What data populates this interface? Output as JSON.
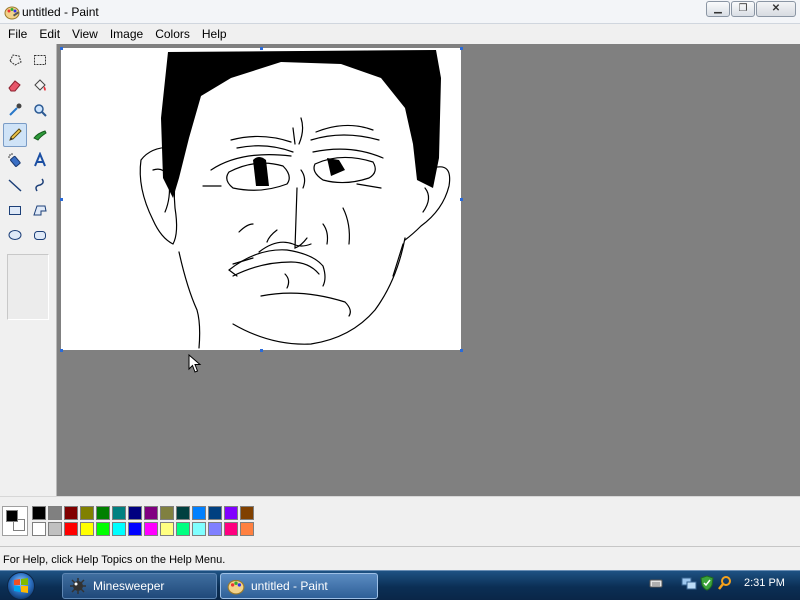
{
  "window": {
    "title": "untitled - Paint",
    "icon": "paint-app-icon",
    "controls": [
      "minimize-icon",
      "maximize-icon",
      "close-icon"
    ]
  },
  "menu": [
    "File",
    "Edit",
    "View",
    "Image",
    "Colors",
    "Help"
  ],
  "tools": [
    {
      "name": "free-form-select",
      "icon": "free-form-select-icon"
    },
    {
      "name": "select",
      "icon": "rect-select-icon"
    },
    {
      "name": "eraser",
      "icon": "eraser-icon"
    },
    {
      "name": "fill-with-color",
      "icon": "paint-bucket-icon"
    },
    {
      "name": "pick-color",
      "icon": "eyedropper-icon"
    },
    {
      "name": "magnifier",
      "icon": "magnifier-icon"
    },
    {
      "name": "pencil",
      "icon": "pencil-icon",
      "active": true
    },
    {
      "name": "brush",
      "icon": "brush-icon"
    },
    {
      "name": "airbrush",
      "icon": "airbrush-icon"
    },
    {
      "name": "text",
      "icon": "text-icon"
    },
    {
      "name": "line",
      "icon": "line-icon"
    },
    {
      "name": "curve",
      "icon": "curve-icon"
    },
    {
      "name": "rectangle",
      "icon": "rectangle-icon"
    },
    {
      "name": "polygon",
      "icon": "polygon-icon"
    },
    {
      "name": "ellipse",
      "icon": "ellipse-icon"
    },
    {
      "name": "rounded-rectangle",
      "icon": "rounded-rectangle-icon"
    }
  ],
  "palette": {
    "foreground": "#000000",
    "background": "#ffffff",
    "row1": [
      "#000000",
      "#808080",
      "#800000",
      "#808000",
      "#008000",
      "#008080",
      "#000080",
      "#800080",
      "#808040",
      "#004040",
      "#0080ff",
      "#004080",
      "#8000ff",
      "#804000"
    ],
    "row2": [
      "#ffffff",
      "#c0c0c0",
      "#ff0000",
      "#ffff00",
      "#00ff00",
      "#00ffff",
      "#0000ff",
      "#ff00ff",
      "#ffff80",
      "#00ff80",
      "#80ffff",
      "#8080ff",
      "#ff0080",
      "#ff8040"
    ]
  },
  "status": {
    "help_text": "For Help, click Help Topics on the Help Menu."
  },
  "taskbar": {
    "start_icon": "windows-logo-icon",
    "buttons": [
      {
        "label": "Minesweeper",
        "icon": "minesweeper-icon",
        "active": false
      },
      {
        "label": "untitled - Paint",
        "icon": "paint-app-icon",
        "active": true
      }
    ],
    "tray_icons": [
      "keyboard-icon",
      "network-icon",
      "security-icon",
      "search-icon"
    ],
    "clock": "2:31 PM"
  }
}
